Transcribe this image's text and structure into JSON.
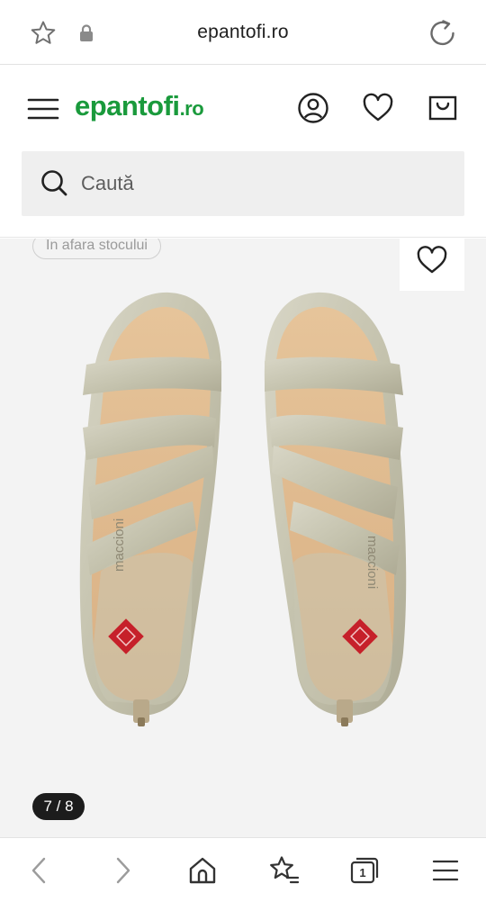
{
  "browser": {
    "url": "epantofi.ro",
    "icons": [
      "star-outline-icon",
      "lock-icon",
      "reload-icon"
    ]
  },
  "header": {
    "logo_main": "epantofi",
    "logo_tld": ".ro",
    "brand_color": "#1a9a3c",
    "icons": [
      "hamburger-menu-icon",
      "account-icon",
      "heart-icon",
      "shopping-bag-icon"
    ]
  },
  "search": {
    "placeholder": "Caută",
    "icon": "search-icon"
  },
  "product": {
    "stock_badge": "În afara stocului",
    "image_brand_text": "maccioni",
    "gallery": {
      "current": 7,
      "total": 8,
      "counter_label": "7 / 8"
    }
  },
  "bottom_nav": {
    "tab_count": "1",
    "icons": [
      "back-icon",
      "forward-icon",
      "home-icon",
      "favorites-icon",
      "tabs-icon",
      "menu-icon"
    ]
  }
}
